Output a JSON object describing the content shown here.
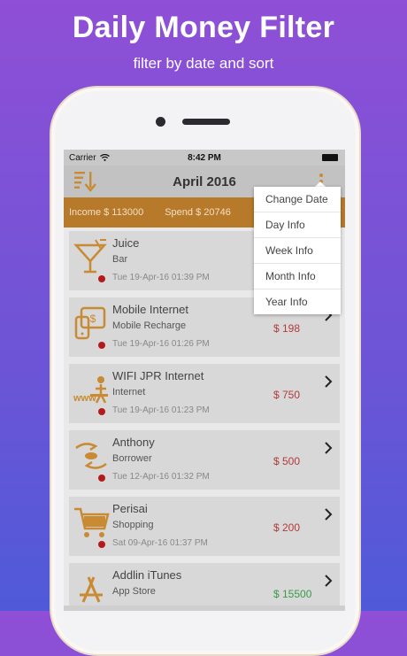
{
  "banner": {
    "title": "Daily Money Filter",
    "subtitle": "filter by date and sort"
  },
  "status": {
    "carrier": "Carrier",
    "time": "8:42 PM"
  },
  "nav": {
    "title": "April 2016",
    "sort_icon": "sort-descending-icon",
    "more_icon": "more-vertical-icon"
  },
  "summary": {
    "income": "Income $ 113000",
    "spend": "Spend $ 20746"
  },
  "colors": {
    "accent": "#c98a34",
    "summary_bg": "#b77a2a",
    "negative": "#b33a3a",
    "positive": "#3a9a4a"
  },
  "menu": {
    "items": [
      {
        "label": "Change Date"
      },
      {
        "label": "Day Info"
      },
      {
        "label": "Week Info"
      },
      {
        "label": "Month Info"
      },
      {
        "label": "Year Info"
      }
    ]
  },
  "transactions": [
    {
      "name": "Juice",
      "category": "Bar",
      "date": "Tue 19-Apr-16 01:39 PM",
      "amount": "",
      "icon": "cocktail-icon"
    },
    {
      "name": "Mobile Internet",
      "category": "Mobile Recharge",
      "date": "Tue 19-Apr-16 01:26 PM",
      "amount": "$ 198",
      "icon": "mobile-recharge-icon"
    },
    {
      "name": "WIFI JPR Internet",
      "category": "Internet",
      "date": "Tue 19-Apr-16 01:23 PM",
      "amount": "$ 750",
      "icon": "internet-www-icon"
    },
    {
      "name": "Anthony",
      "category": "Borrower",
      "date": "Tue 12-Apr-16 01:32 PM",
      "amount": "$ 500",
      "icon": "hand-money-icon"
    },
    {
      "name": "Perisai",
      "category": "Shopping",
      "date": "Sat 09-Apr-16 01:37 PM",
      "amount": "$ 200",
      "icon": "shopping-cart-icon"
    },
    {
      "name": "Addlin iTunes",
      "category": "App Store",
      "date": "",
      "amount": "$ 15500",
      "icon": "app-store-icon"
    }
  ]
}
